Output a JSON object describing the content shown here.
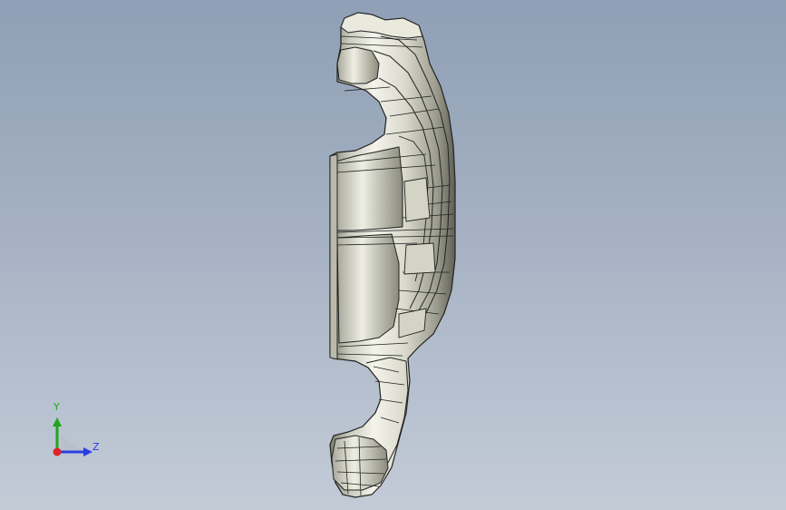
{
  "view": {
    "background_top": "#8f9fb5",
    "background_bottom": "#c3cbd7"
  },
  "model": {
    "name": "",
    "shading": "shaded-with-edges",
    "surface_color": "#d8d8cc",
    "edge_color": "#1a1a1a"
  },
  "triad": {
    "y_label": "Y",
    "z_label": "Z",
    "y_color": "#1fa51f",
    "z_color": "#2a3fe0",
    "x_color": "#e0232a"
  }
}
